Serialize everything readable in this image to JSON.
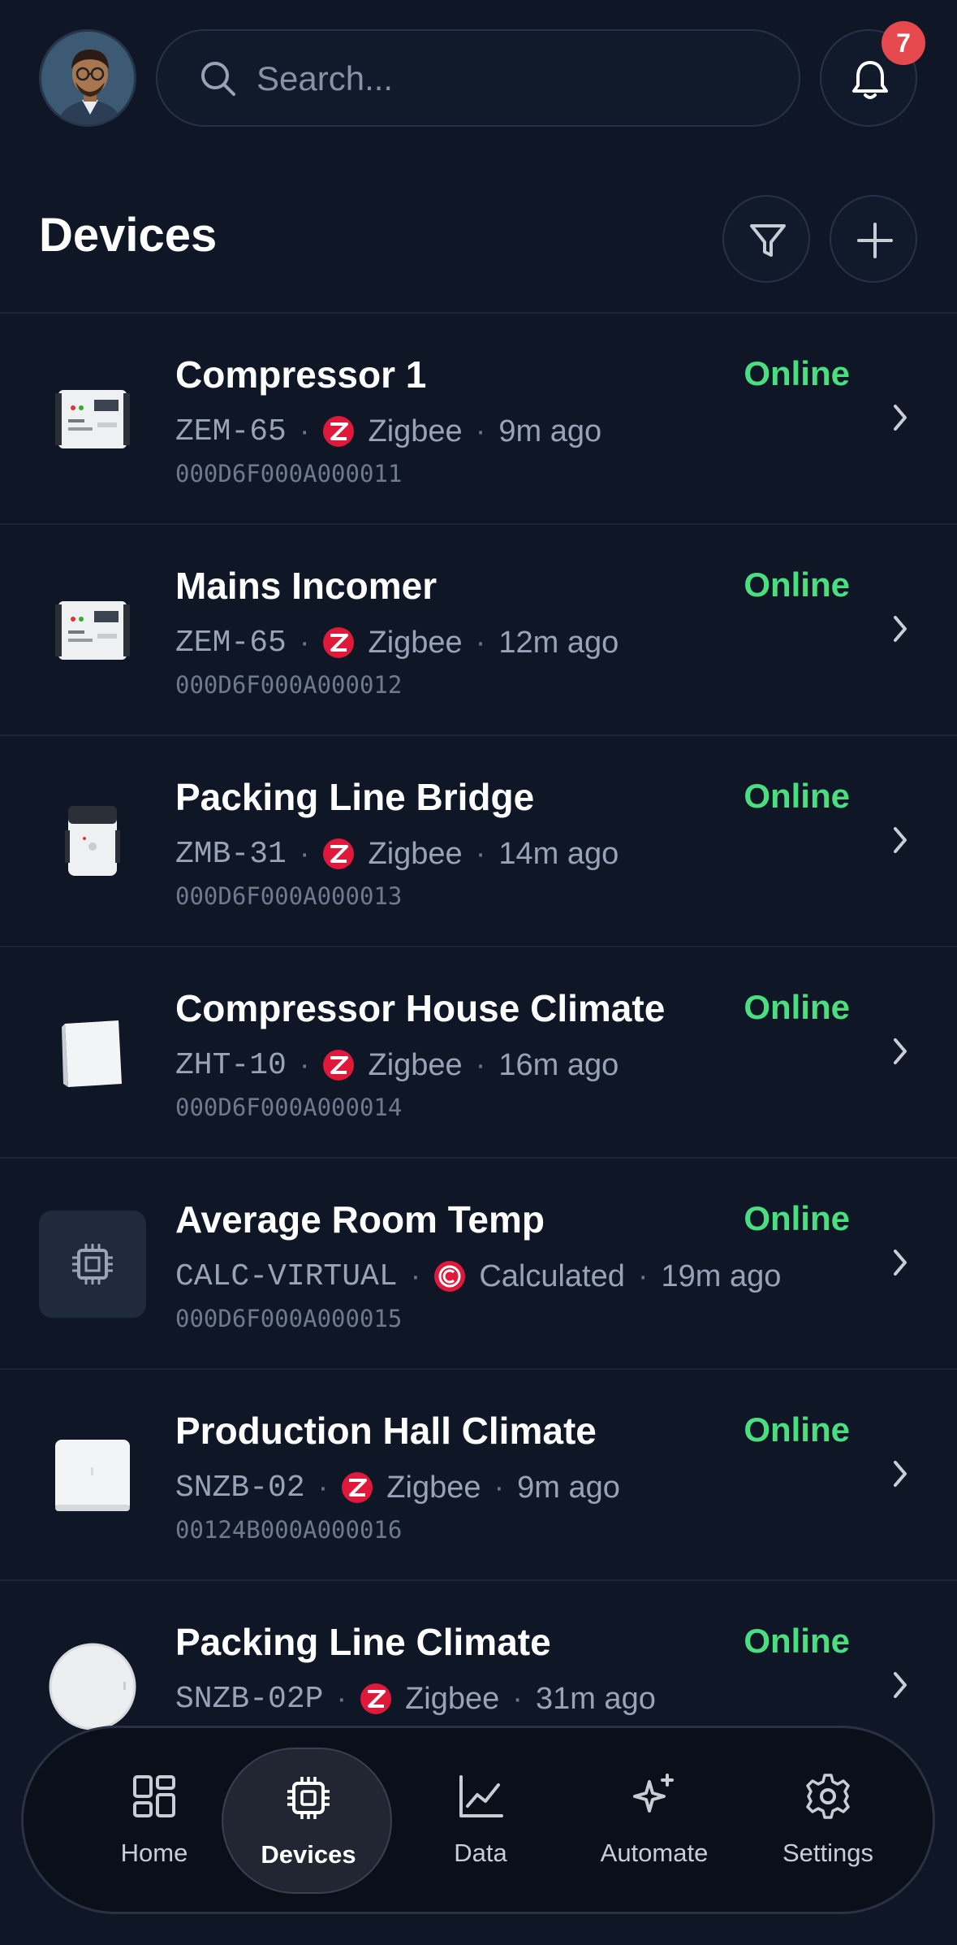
{
  "header": {
    "search_placeholder": "Search...",
    "notification_count": "7",
    "page_title": "Devices"
  },
  "colors": {
    "background": "#0f1626",
    "online": "#4ade80",
    "badge": "#e5484d",
    "zigbee": "#e0193b"
  },
  "devices": [
    {
      "name": "Compressor 1",
      "status": "Online",
      "model": "ZEM-65",
      "protocol": "Zigbee",
      "protocol_icon": "zigbee-icon",
      "last_seen": "9m ago",
      "id": "000D6F000A000011"
    },
    {
      "name": "Mains Incomer",
      "status": "Online",
      "model": "ZEM-65",
      "protocol": "Zigbee",
      "protocol_icon": "zigbee-icon",
      "last_seen": "12m ago",
      "id": "000D6F000A000012"
    },
    {
      "name": "Packing Line Bridge",
      "status": "Online",
      "model": "ZMB-31",
      "protocol": "Zigbee",
      "protocol_icon": "zigbee-icon",
      "last_seen": "14m ago",
      "id": "000D6F000A000013"
    },
    {
      "name": "Compressor House Climate",
      "status": "Online",
      "model": "ZHT-10",
      "protocol": "Zigbee",
      "protocol_icon": "zigbee-icon",
      "last_seen": "16m ago",
      "id": "000D6F000A000014"
    },
    {
      "name": "Average Room Temp",
      "status": "Online",
      "model": "CALC-VIRTUAL",
      "protocol": "Calculated",
      "protocol_icon": "calculated-icon",
      "last_seen": "19m ago",
      "id": "000D6F000A000015"
    },
    {
      "name": "Production Hall Climate",
      "status": "Online",
      "model": "SNZB-02",
      "protocol": "Zigbee",
      "protocol_icon": "zigbee-icon",
      "last_seen": "9m ago",
      "id": "00124B000A000016"
    },
    {
      "name": "Packing Line Climate",
      "status": "Online",
      "model": "SNZB-02P",
      "protocol": "Zigbee",
      "protocol_icon": "zigbee-icon",
      "last_seen": "31m ago",
      "id": ""
    }
  ],
  "nav": {
    "items": [
      {
        "label": "Home",
        "icon": "grid-icon"
      },
      {
        "label": "Devices",
        "icon": "chip-icon",
        "active": true
      },
      {
        "label": "Data",
        "icon": "chart-icon"
      },
      {
        "label": "Automate",
        "icon": "sparkle-icon"
      },
      {
        "label": "Settings",
        "icon": "gear-icon"
      }
    ]
  }
}
